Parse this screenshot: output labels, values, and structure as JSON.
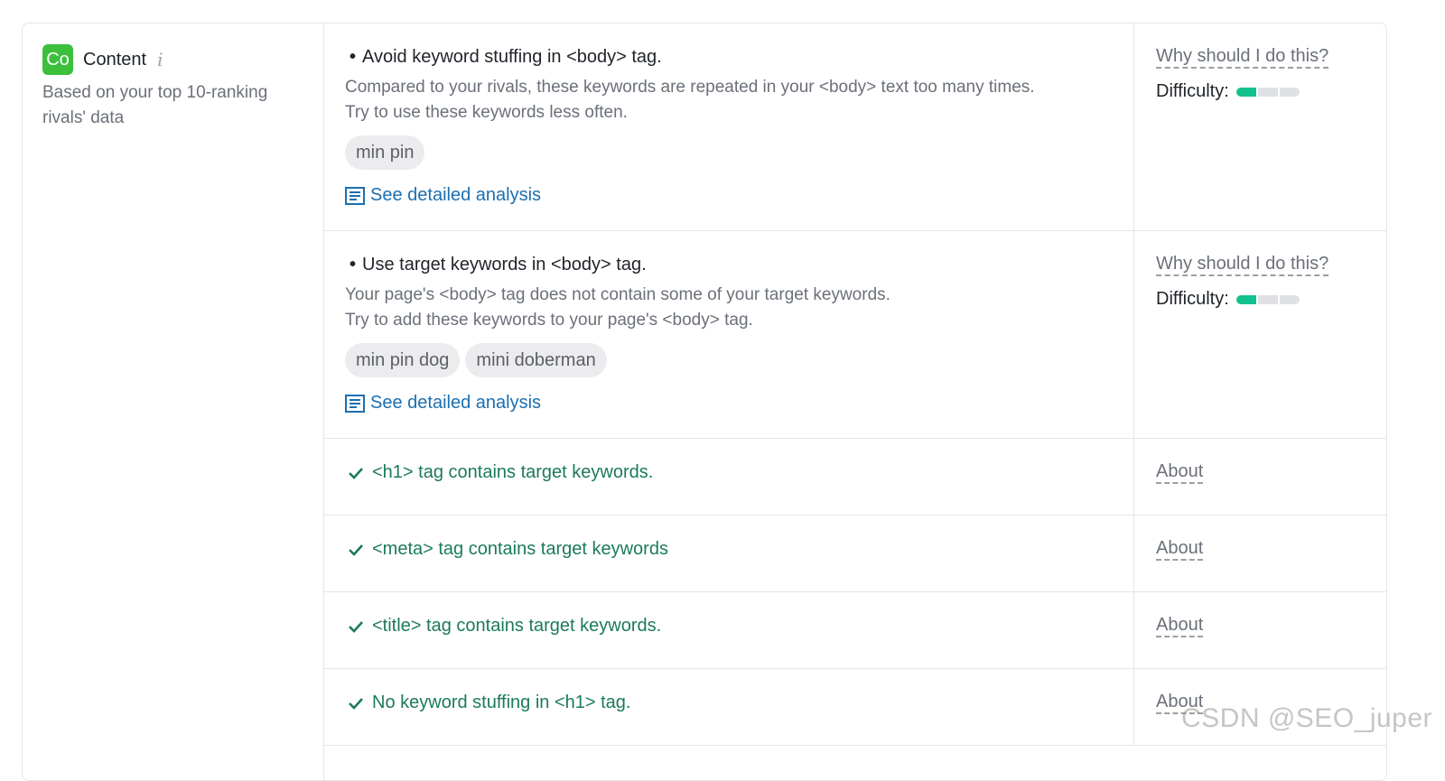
{
  "category": {
    "badge": "Co",
    "title": "Content",
    "info_icon": "i",
    "subtitle": "Based on your top 10-ranking rivals' data",
    "badge_color": "#3cbf3c"
  },
  "issues": [
    {
      "title": "Avoid keyword stuffing in <body> tag.",
      "desc_line1": "Compared to your rivals, these keywords are repeated in your <body> text too many times.",
      "desc_line2": "Try to use these keywords less often.",
      "chips": [
        "min pin"
      ],
      "link": "See detailed analysis",
      "why": "Why should I do this?",
      "difficulty_label": "Difficulty:",
      "difficulty_level": 1,
      "difficulty_max": 3
    },
    {
      "title": "Use target keywords in <body> tag.",
      "desc_line1": "Your page's <body> tag does not contain some of your target keywords.",
      "desc_line2": "Try to add these keywords to your page's <body> tag.",
      "chips": [
        "min pin dog",
        "mini doberman"
      ],
      "link": "See detailed analysis",
      "why": "Why should I do this?",
      "difficulty_label": "Difficulty:",
      "difficulty_level": 1,
      "difficulty_max": 3
    }
  ],
  "passed": [
    {
      "text": "<h1> tag contains target keywords.",
      "about": "About"
    },
    {
      "text": "<meta> tag contains target keywords",
      "about": "About"
    },
    {
      "text": "<title> tag contains target keywords.",
      "about": "About"
    },
    {
      "text": "No keyword stuffing in <h1> tag.",
      "about": "About"
    }
  ],
  "icons": {
    "analysis": "document-icon",
    "passed": "check-icon",
    "info": "info-icon"
  },
  "colors": {
    "link": "#1b6fb0",
    "passed_text": "#1b7a5c",
    "difficulty_fill": "#12c28e"
  },
  "watermark": "CSDN @SEO_juper"
}
